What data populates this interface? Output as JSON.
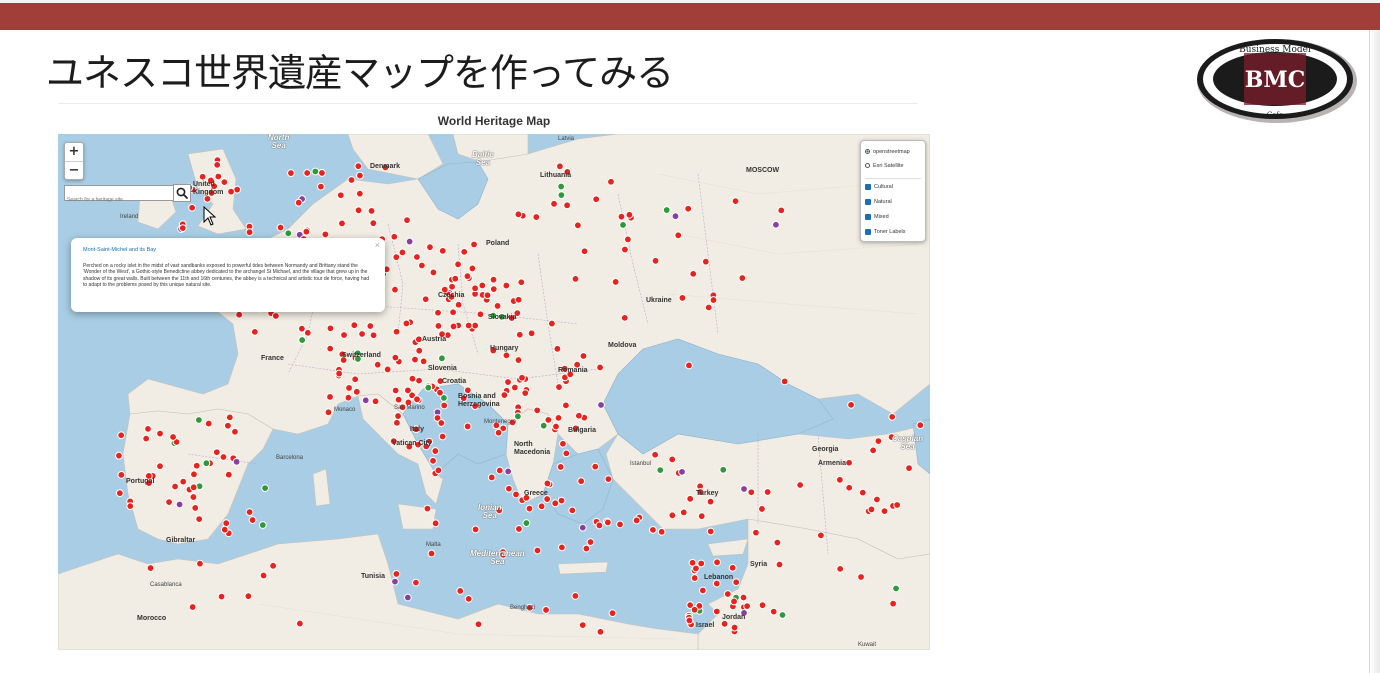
{
  "slide": {
    "title": "ユネスコ世界遺産マップを作ってみる",
    "logo": {
      "top_text": "Business Model",
      "center_text": "BMC",
      "bottom_text": "Cafe"
    }
  },
  "map": {
    "title": "World Heritage Map",
    "zoom_in_label": "+",
    "zoom_out_label": "−",
    "search_placeholder": "Search for a heritage site",
    "popup": {
      "title": "Mont-Saint-Michel and its Bay",
      "text": "Perched on a rocky islet in the midst of vast sandbanks exposed to powerful tides between Normandy and Brittany stand the 'Wonder of the West', a Gothic-style Benedictine abbey dedicated to the archangel St Michael, and the village that grew up in the shadow of its great walls. Built between the 11th and 16th centuries, the abbey is a technical and artistic tour de force, having had to adapt to the problems posed by this unique natural site.",
      "close_label": "×"
    },
    "layers": {
      "base": [
        {
          "label": "openstreetmap",
          "selected": true
        },
        {
          "label": "Esri Satellite",
          "selected": false
        }
      ],
      "overlays": [
        {
          "label": "Cultural",
          "checked": true
        },
        {
          "label": "Natural",
          "checked": true
        },
        {
          "label": "Mixed",
          "checked": true
        },
        {
          "label": "Toner Labels",
          "checked": true
        }
      ]
    },
    "labels": {
      "north_sea": "North\nSea",
      "baltic_sea": "Baltic\nSea",
      "latvia": "Latvia",
      "moscow": "MOSCOW",
      "denmark": "Denmark",
      "lithuania": "Lithuania",
      "ireland": "Ireland",
      "united_kingdom": "United\nKingdom",
      "poland": "Poland",
      "czechia": "Czechia",
      "ukraine": "Ukraine",
      "slovakia": "Slovakia",
      "france": "France",
      "switzerland": "Switzerland",
      "austria": "Austria",
      "hungary": "Hungary",
      "moldova": "Moldova",
      "slovenia": "Slovenia",
      "croatia": "Croatia",
      "romania": "Romania",
      "monaco": "Monaco",
      "bosnia": "Bosnia and\nHerzegovina",
      "montenegro": "Montenegro",
      "bulgaria": "Bulgaria",
      "san_marino": "San Marino",
      "italy": "Italy",
      "vatican": "Vatican City",
      "north_macedonia": "North\nMacedonia",
      "georgia": "Georgia",
      "armenia": "Armenia",
      "caspian_sea": "Caspian\nSea",
      "istanbul": "Istanbul",
      "turkey": "Turkey",
      "greece": "Greece",
      "portugal": "Portugal",
      "barcelona": "Barcelona",
      "ionian_sea": "Ionian\nSea",
      "gibraltar": "Gibraltar",
      "malta": "Malta",
      "mediterranean_sea": "Mediterranean\nSea",
      "syria": "Syria",
      "tunisia": "Tunisia",
      "casablanca": "Casablanca",
      "lebanon": "Lebanon",
      "morocco": "Morocco",
      "benghazi": "Benghazi",
      "israel": "Israel",
      "jordan": "Jordan",
      "kuwait": "Kuwait"
    }
  },
  "colors": {
    "top_bar": "#a23e3a",
    "cultural_marker": "#e8231e",
    "natural_marker": "#2c9a3b",
    "mixed_marker": "#8a3fa0",
    "sea": "#a8cde4",
    "land": "#f1ede4"
  }
}
